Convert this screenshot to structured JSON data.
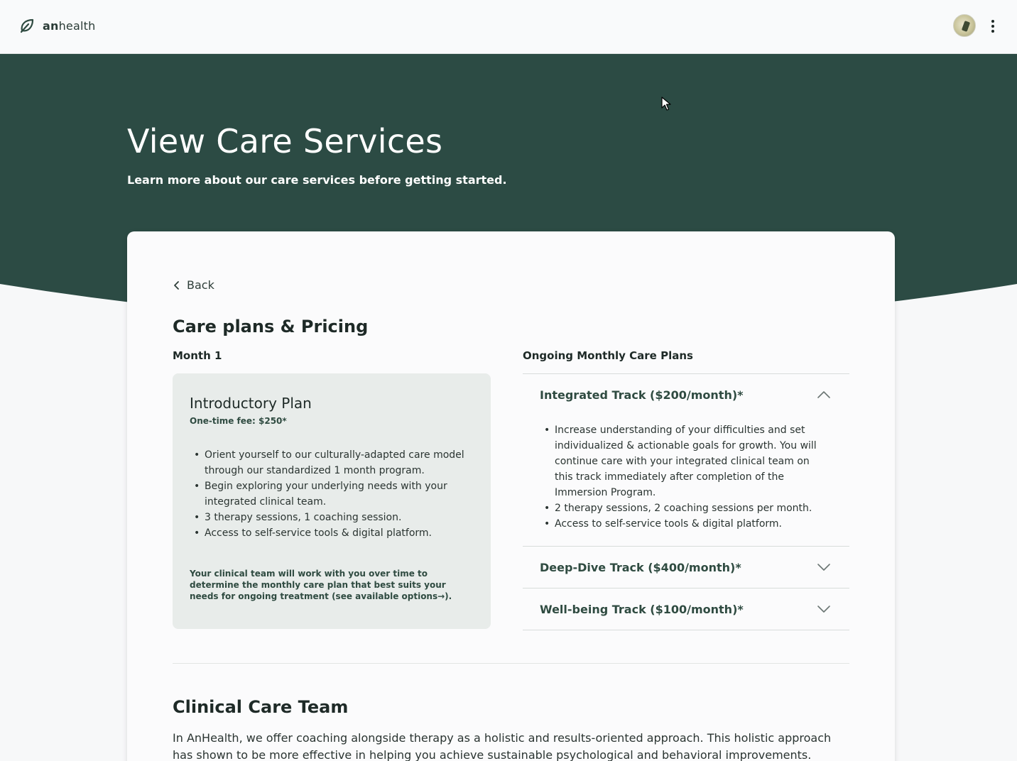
{
  "app": {
    "logo_text_bold": "an",
    "logo_text_rest": "health"
  },
  "hero": {
    "title": "View Care Services",
    "subtitle": "Learn more about our care services before getting started."
  },
  "nav": {
    "back_label": "Back"
  },
  "pricing": {
    "section_title": "Care plans & Pricing",
    "month_label": "Month 1",
    "intro": {
      "title": "Introductory Plan",
      "fee": "One-time fee: $250*",
      "bullets": [
        "Orient yourself to our culturally-adapted care model through our standardized 1 month program.",
        "Begin exploring your underlying needs with your integrated clinical team.",
        "3 therapy sessions, 1 coaching session.",
        "Access to self-service tools & digital platform."
      ],
      "note": "Your clinical team will work with you over time to determine the monthly care plan that best suits your needs for ongoing treatment (see available options→)."
    },
    "ongoing_label": "Ongoing Monthly Care Plans",
    "tracks": [
      {
        "title": "Integrated Track ($200/month)*",
        "expanded": true,
        "bullets": [
          "Increase understanding of your difficulties and set individualized & actionable goals for growth. You will continue care with your integrated clinical team on this track immediately after completion of the Immersion Program.",
          "2 therapy sessions, 2 coaching sessions per month.",
          "Access to self-service tools & digital platform."
        ]
      },
      {
        "title": "Deep-Dive Track ($400/month)*",
        "expanded": false
      },
      {
        "title": "Well-being Track ($100/month)*",
        "expanded": false
      }
    ]
  },
  "team": {
    "title": "Clinical Care Team",
    "text": "In AnHealth, we offer coaching alongside therapy as a holistic and results-oriented approach. This holistic approach has shown to be more effective in helping you achieve sustainable psychological and behavioral improvements."
  },
  "colors": {
    "hero_bg": "#2c4b44",
    "accent_text": "#2f4b41",
    "card_bg": "#fbfbfc",
    "intro_box_bg": "#e8ecea"
  },
  "icons": {
    "logo": "leaf-icon",
    "menu": "kebab-menu-icon",
    "back": "chevron-left-icon",
    "expanded": "chevron-up-icon",
    "collapsed": "chevron-down-icon",
    "cursor": "mouse-cursor-icon"
  }
}
